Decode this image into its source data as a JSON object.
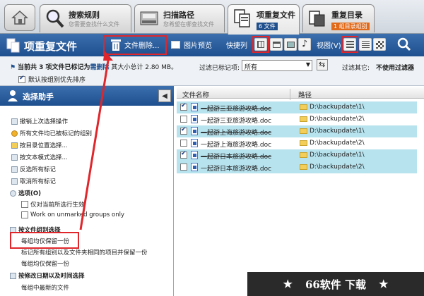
{
  "tabs": {
    "home": {
      "icon": "home-icon"
    },
    "search_rules": {
      "title": "搜索规则",
      "subtitle": "您需要查找什么文件"
    },
    "scan_paths": {
      "title": "扫描路径",
      "subtitle": "您希望在哪查找文件"
    },
    "duplicates": {
      "title": "项重复文件",
      "badge": "6 文件"
    },
    "dup_dirs": {
      "title": "重复目录",
      "badge": "1 组目录组别"
    }
  },
  "toolbar": {
    "title": "项重复文件",
    "delete_label": "文件删除...",
    "preview_label": "图片预览",
    "quicklist_label": "快捷列",
    "view_label": "视图(V)",
    "colors": {
      "bar": "#1e4f8e",
      "highlight": "#e0262b"
    }
  },
  "infobar": {
    "status_prefix": "当前共 3 项文件已标记为",
    "status_action": "需删除",
    "status_suffix": "其大小总计 2.80 MB。",
    "filter_label": "过滤已标记项:",
    "filter_value": "所有",
    "other_filter_label": "过滤其它:",
    "other_filter_value": "不使用过滤器",
    "priority_label": "默认按组别优先排序"
  },
  "assistant": {
    "title": "选择助手",
    "items": [
      "撤销上次选择操作",
      "所有文件均已被标记的组别",
      "按目录位置选择...",
      "按文本模式选择...",
      "反选所有标记",
      "取消所有标记"
    ],
    "options_header": "选项(O)",
    "option_1": "仅对当前所选行生效",
    "option_2": "Work on unmarked groups only",
    "group_header": "按文件组别选择",
    "group_item_1": "每组均仅保留一份",
    "group_item_2": "标记所有组别以及文件夹相同的项目并保留一份",
    "group_item_3": "每组均仅保留一份",
    "date_header": "按修改日期以及时间选择",
    "date_item_1": "每组中最新的文件"
  },
  "table": {
    "col_name": "文件名称",
    "col_path": "路径",
    "rows": [
      {
        "name": "一起游三亚旅游攻略.doc",
        "path": "D:\\backupdate\\1\\",
        "checked": true
      },
      {
        "name": "一起游三亚旅游攻略.doc",
        "path": "D:\\backupdate\\2\\",
        "checked": false
      },
      {
        "name": "一起游上海旅游攻略.doc",
        "path": "D:\\backupdate\\1\\",
        "checked": true
      },
      {
        "name": "一起游上海旅游攻略.doc",
        "path": "D:\\backupdate\\2\\",
        "checked": false
      },
      {
        "name": "一起游日本旅游攻略.doc",
        "path": "D:\\backupdate\\1\\",
        "checked": true
      },
      {
        "name": "一起游日本旅游攻略.doc",
        "path": "D:\\backupdate\\2\\",
        "checked": false
      }
    ]
  },
  "watermark": {
    "text": "66软件 下载",
    "star": "★"
  }
}
